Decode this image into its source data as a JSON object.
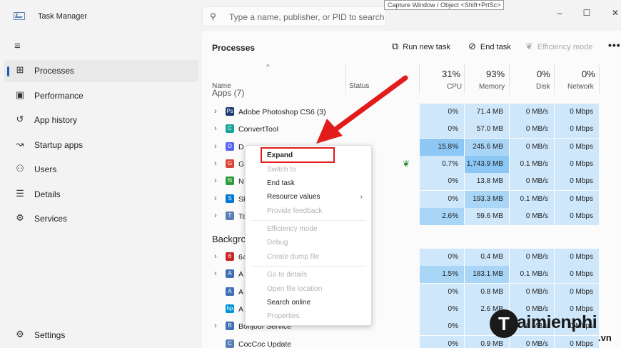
{
  "window": {
    "title": "Task Manager",
    "tooltip": "Capture Window / Object <Shift+PrtSc>",
    "controls": {
      "minimize": "–",
      "maximize": "☐",
      "close": "✕"
    }
  },
  "search": {
    "placeholder": "Type a name, publisher, or PID to search"
  },
  "nav": {
    "items": [
      {
        "label": "Processes",
        "icon": "processes-icon",
        "glyph": "⊞",
        "active": true
      },
      {
        "label": "Performance",
        "icon": "performance-icon",
        "glyph": "▣"
      },
      {
        "label": "App history",
        "icon": "history-icon",
        "glyph": "↺"
      },
      {
        "label": "Startup apps",
        "icon": "startup-icon",
        "glyph": "↝"
      },
      {
        "label": "Users",
        "icon": "users-icon",
        "glyph": "⚇"
      },
      {
        "label": "Details",
        "icon": "details-icon",
        "glyph": "☰"
      },
      {
        "label": "Services",
        "icon": "services-icon",
        "glyph": "⚙"
      }
    ],
    "settings": {
      "label": "Settings",
      "glyph": "⚙"
    }
  },
  "toolbar": {
    "title": "Processes",
    "run_new_task": "Run new task",
    "end_task": "End task",
    "efficiency_mode": "Efficiency mode",
    "more": "•••"
  },
  "columns": {
    "sort_glyph": "^",
    "name": "Name",
    "status": "Status",
    "cpu": {
      "pct": "31%",
      "label": "CPU"
    },
    "memory": {
      "pct": "93%",
      "label": "Memory"
    },
    "disk": {
      "pct": "0%",
      "label": "Disk"
    },
    "network": {
      "pct": "0%",
      "label": "Network"
    }
  },
  "groups": {
    "apps": "Apps (7)",
    "background": "Backgro"
  },
  "apps": [
    {
      "name": "Adobe Photoshop CS6 (3)",
      "icon_color": "#1d3a6e",
      "glyph": "Ps",
      "cpu": "0%",
      "mem": "71.4 MB",
      "disk": "0 MB/s",
      "net": "0 Mbps"
    },
    {
      "name": "ConvertTool",
      "icon_color": "#1aa39a",
      "glyph": "C",
      "cpu": "0%",
      "mem": "57.0 MB",
      "disk": "0 MB/s",
      "net": "0 Mbps"
    },
    {
      "name": "D",
      "icon_color": "#5865f2",
      "glyph": "D",
      "cpu": "15.8%",
      "mem": "245.6 MB",
      "disk": "0 MB/s",
      "net": "0 Mbps"
    },
    {
      "name": "G",
      "icon_color": "#db4437",
      "glyph": "G",
      "cpu": "0.7%",
      "mem": "1,743.9 MB",
      "disk": "0.1 MB/s",
      "net": "0 Mbps",
      "status_leaf": true
    },
    {
      "name": "N",
      "icon_color": "#2d9c3f",
      "glyph": "N",
      "cpu": "0%",
      "mem": "13.8 MB",
      "disk": "0 MB/s",
      "net": "0 Mbps"
    },
    {
      "name": "Sk",
      "icon_color": "#0078d4",
      "glyph": "S",
      "cpu": "0%",
      "mem": "193.3 MB",
      "disk": "0.1 MB/s",
      "net": "0 Mbps"
    },
    {
      "name": "Ta",
      "icon_color": "#5a7fb5",
      "glyph": "T",
      "cpu": "2.6%",
      "mem": "59.6 MB",
      "disk": "0 MB/s",
      "net": "0 Mbps"
    }
  ],
  "background": [
    {
      "name": "64",
      "icon_color": "#c62828",
      "glyph": "6",
      "cpu": "0%",
      "mem": "0.4 MB",
      "disk": "0 MB/s",
      "net": "0 Mbps",
      "chevron": true
    },
    {
      "name": "A",
      "icon_color": "#3f6fb5",
      "glyph": "A",
      "cpu": "1.5%",
      "mem": "183.1 MB",
      "disk": "0.1 MB/s",
      "net": "0 Mbps",
      "chevron": true
    },
    {
      "name": "A",
      "icon_color": "#3f6fb5",
      "glyph": "A",
      "cpu": "0%",
      "mem": "0.8 MB",
      "disk": "0 MB/s",
      "net": "0 Mbps"
    },
    {
      "name": "A",
      "icon_color": "#0096d6",
      "glyph": "hp",
      "cpu": "0%",
      "mem": "2.6 MB",
      "disk": "0 MB/s",
      "net": "0 Mbps"
    },
    {
      "name": "Bonjour Service",
      "icon_color": "#3f6fb5",
      "glyph": "B",
      "cpu": "0%",
      "mem": "0",
      "disk": "0 MB/s",
      "net": "0 Mbps",
      "chevron": true
    },
    {
      "name": "CocCoc Update",
      "icon_color": "#5a7fb5",
      "glyph": "C",
      "cpu": "0%",
      "mem": "0.9 MB",
      "disk": "0 MB/s",
      "net": "0 Mbps"
    }
  ],
  "context_menu": {
    "items": [
      {
        "label": "Expand",
        "bold": true
      },
      {
        "label": "Switch to",
        "disabled": true
      },
      {
        "label": "End task"
      },
      {
        "label": "Resource values",
        "submenu": true,
        "arrow": "›"
      },
      {
        "label": "Provide feedback",
        "disabled": true
      },
      {
        "label": "Efficiency mode",
        "disabled": true
      },
      {
        "label": "Debug",
        "disabled": true
      },
      {
        "label": "Create dump file",
        "disabled": true
      },
      {
        "label": "Go to details",
        "disabled": true
      },
      {
        "label": "Open file location",
        "disabled": true
      },
      {
        "label": "Search online"
      },
      {
        "label": "Properties",
        "disabled": true
      }
    ]
  },
  "watermark": {
    "initial": "T",
    "text": "aimienphi",
    "sub": ".vn"
  },
  "colors": {
    "heat_low": "#cfe7fb",
    "heat_mid": "#a9d5f7",
    "heat_high": "#8cc7f5",
    "accent": "#1a5fb4",
    "red": "#e21b1b"
  }
}
